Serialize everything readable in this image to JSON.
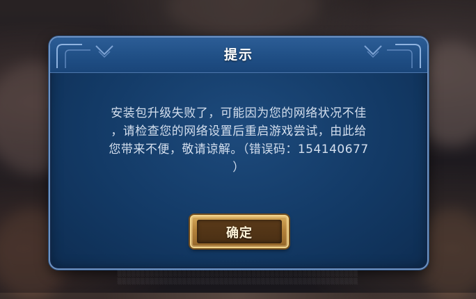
{
  "dialog": {
    "title": "提示",
    "message_lines": [
      "安装包升级失败了，可能因为您的网络状况不佳",
      "，请检查您的网络设置后重启游戏尝试，由此给",
      "您带来不便，敬请谅解。（错误码：154140677",
      "）"
    ],
    "confirm_label": "确定"
  },
  "colors": {
    "dialog_bg": "#133a66",
    "dialog_border": "#6e93c4",
    "title_text": "#ffffff",
    "message_text": "#d4dfee",
    "button_gold": "#d5a95a",
    "button_text": "#fff3d8"
  }
}
